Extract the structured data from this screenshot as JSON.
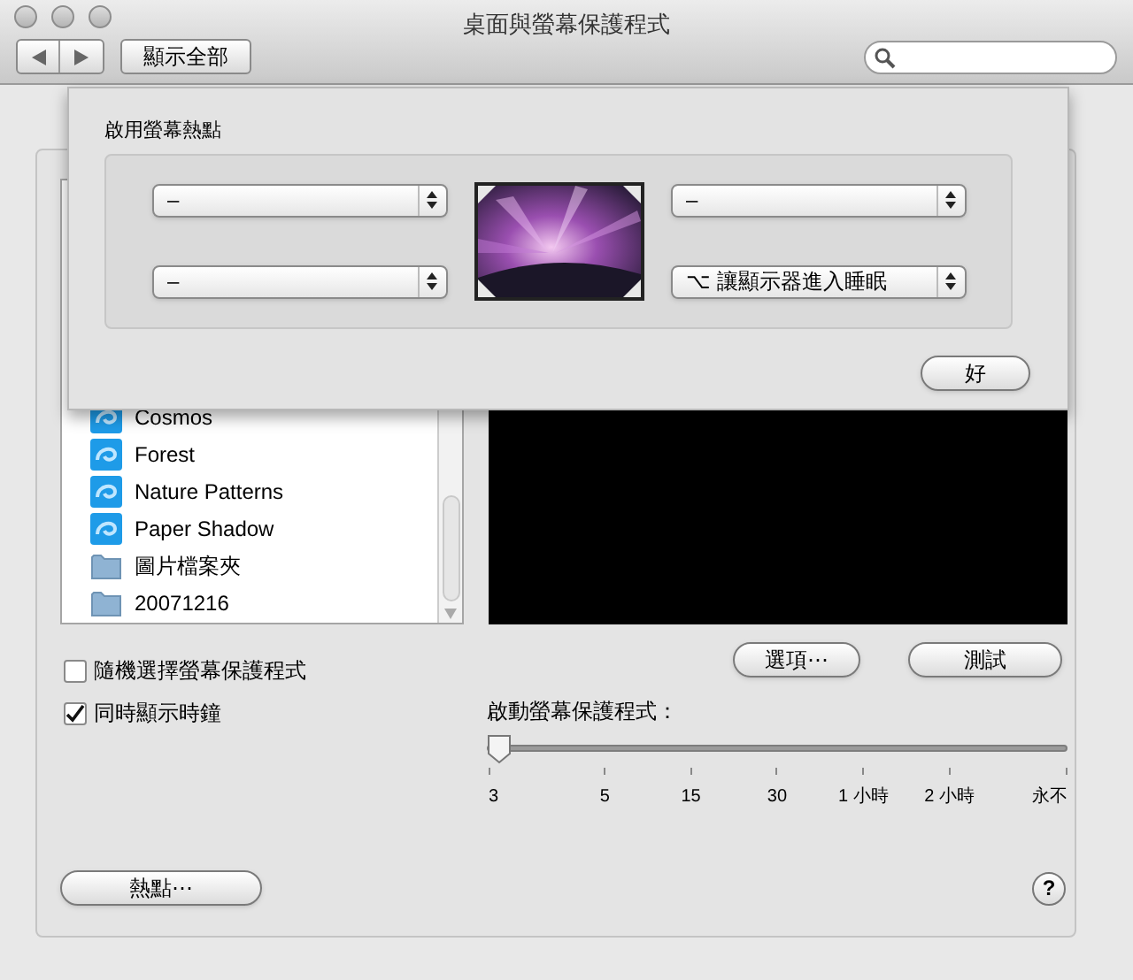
{
  "window": {
    "title": "桌面與螢幕保護程式"
  },
  "toolbar": {
    "show_all": "顯示全部"
  },
  "screen_savers": {
    "items": [
      {
        "label": "Cosmos",
        "kind": "saver"
      },
      {
        "label": "Forest",
        "kind": "saver"
      },
      {
        "label": "Nature Patterns",
        "kind": "saver"
      },
      {
        "label": "Paper Shadow",
        "kind": "saver"
      },
      {
        "label": "圖片檔案夾",
        "kind": "folder"
      },
      {
        "label": "20071216",
        "kind": "folder"
      }
    ]
  },
  "options": [
    {
      "label": "隨機選擇螢幕保護程式",
      "checked": false
    },
    {
      "label": "同時顯示時鐘",
      "checked": true
    }
  ],
  "buttons": {
    "options": "選項⋯",
    "test": "測試"
  },
  "start": {
    "label": "啟動螢幕保護程式：",
    "level": 0,
    "ticks": [
      "3",
      "5",
      "15",
      "30",
      "1 小時",
      "2 小時",
      "永不"
    ]
  },
  "hot_corners_button": "熱點⋯",
  "help": "?",
  "sheet": {
    "title": "啟用螢幕熱點",
    "corners": [
      {
        "value": "–"
      },
      {
        "value": "–"
      },
      {
        "value": "–"
      },
      {
        "value": "⌥ 讓顯示器進入睡眠"
      }
    ],
    "ok": "好"
  }
}
